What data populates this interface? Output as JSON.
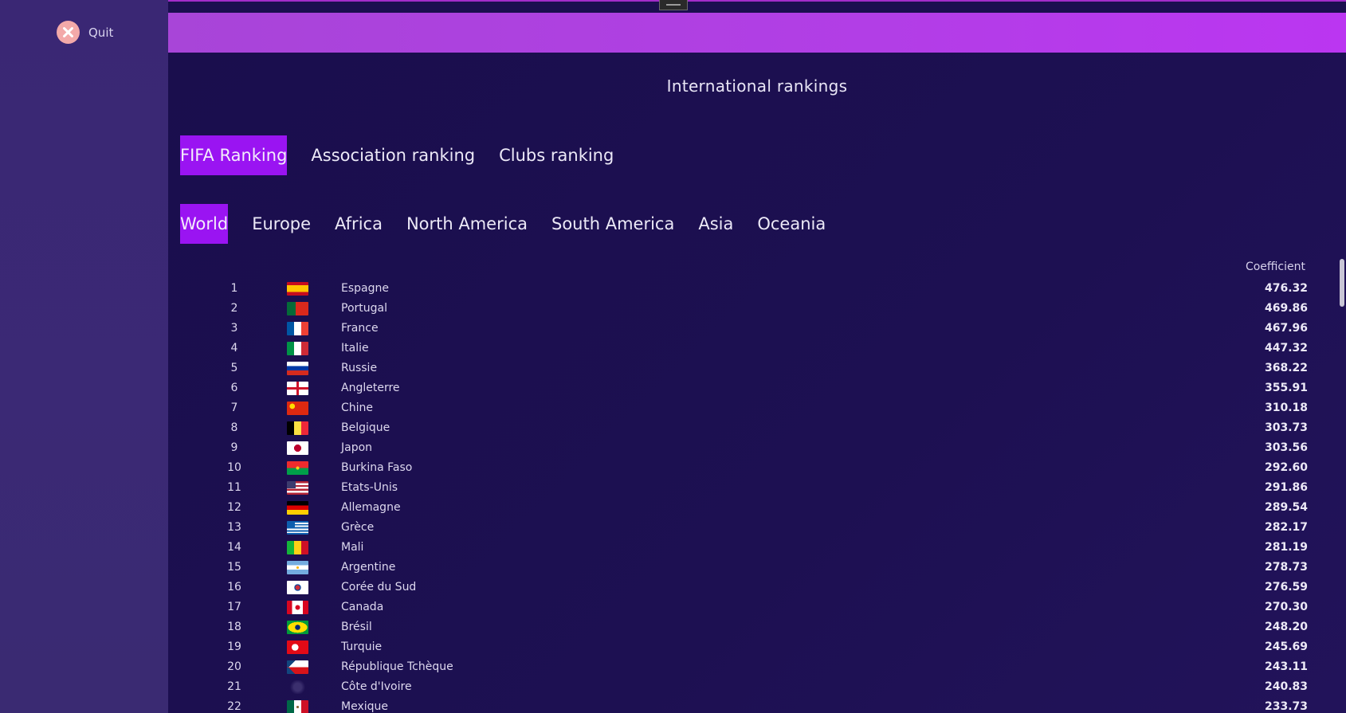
{
  "sidebar": {
    "quit_label": "Quit"
  },
  "page": {
    "title": "International rankings"
  },
  "ranking_tabs": [
    {
      "label": "FIFA Ranking",
      "active": true
    },
    {
      "label": "Association ranking",
      "active": false
    },
    {
      "label": "Clubs ranking",
      "active": false
    }
  ],
  "region_tabs": [
    {
      "label": "World",
      "active": true
    },
    {
      "label": "Europe",
      "active": false
    },
    {
      "label": "Africa",
      "active": false
    },
    {
      "label": "North America",
      "active": false
    },
    {
      "label": "South America",
      "active": false
    },
    {
      "label": "Asia",
      "active": false
    },
    {
      "label": "Oceania",
      "active": false
    }
  ],
  "table": {
    "coefficient_header": "Coefficient",
    "rows": [
      {
        "rank": "1",
        "country": "Espagne",
        "coefficient": "476.32",
        "flag": "flag-spain"
      },
      {
        "rank": "2",
        "country": "Portugal",
        "coefficient": "469.86",
        "flag": "flag-portugal"
      },
      {
        "rank": "3",
        "country": "France",
        "coefficient": "467.96",
        "flag": "flag-france"
      },
      {
        "rank": "4",
        "country": "Italie",
        "coefficient": "447.32",
        "flag": "flag-italy"
      },
      {
        "rank": "5",
        "country": "Russie",
        "coefficient": "368.22",
        "flag": "flag-russia"
      },
      {
        "rank": "6",
        "country": "Angleterre",
        "coefficient": "355.91",
        "flag": "flag-england"
      },
      {
        "rank": "7",
        "country": "Chine",
        "coefficient": "310.18",
        "flag": "flag-china"
      },
      {
        "rank": "8",
        "country": "Belgique",
        "coefficient": "303.73",
        "flag": "flag-belgium"
      },
      {
        "rank": "9",
        "country": "Japon",
        "coefficient": "303.56",
        "flag": "flag-japan"
      },
      {
        "rank": "10",
        "country": "Burkina Faso",
        "coefficient": "292.60",
        "flag": "flag-burkina-faso"
      },
      {
        "rank": "11",
        "country": "Etats-Unis",
        "coefficient": "291.86",
        "flag": "flag-usa"
      },
      {
        "rank": "12",
        "country": "Allemagne",
        "coefficient": "289.54",
        "flag": "flag-germany"
      },
      {
        "rank": "13",
        "country": "Grèce",
        "coefficient": "282.17",
        "flag": "flag-greece"
      },
      {
        "rank": "14",
        "country": "Mali",
        "coefficient": "281.19",
        "flag": "flag-mali"
      },
      {
        "rank": "15",
        "country": "Argentine",
        "coefficient": "278.73",
        "flag": "flag-argentina"
      },
      {
        "rank": "16",
        "country": "Corée du Sud",
        "coefficient": "276.59",
        "flag": "flag-south-korea"
      },
      {
        "rank": "17",
        "country": "Canada",
        "coefficient": "270.30",
        "flag": "flag-canada"
      },
      {
        "rank": "18",
        "country": "Brésil",
        "coefficient": "248.20",
        "flag": "flag-brazil"
      },
      {
        "rank": "19",
        "country": "Turquie",
        "coefficient": "245.69",
        "flag": "flag-turkey"
      },
      {
        "rank": "20",
        "country": "République Tchèque",
        "coefficient": "243.11",
        "flag": "flag-czech-republic"
      },
      {
        "rank": "21",
        "country": "Côte d'Ivoire",
        "coefficient": "240.83",
        "flag": "flag-missing"
      },
      {
        "rank": "22",
        "country": "Mexique",
        "coefficient": "233.73",
        "flag": "flag-mexico"
      }
    ]
  },
  "colors": {
    "accent": "#9a14f2",
    "banner": "#b23ee6",
    "sidebar": "#3a2774",
    "background": "#1b0f4f"
  }
}
